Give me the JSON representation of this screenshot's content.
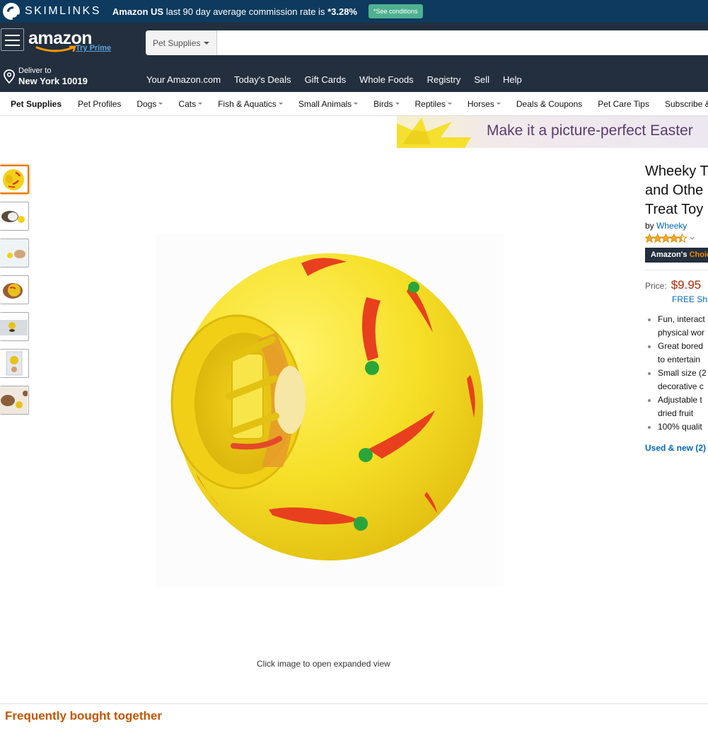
{
  "skimlinks": {
    "brand": "SKIMLINKS",
    "store": "Amazon US",
    "message": "last 90 day average commission rate is",
    "rate": "*3.28%",
    "conditions_button": "*See conditions"
  },
  "header": {
    "logo_text": "amazon",
    "prime_text": "Try Prime",
    "search_category": "Pet Supplies",
    "search_value": "",
    "deliver_to_label": "Deliver to",
    "deliver_location": "New York 10019",
    "nav_links": [
      "Your Amazon.com",
      "Today's Deals",
      "Gift Cards",
      "Whole Foods",
      "Registry",
      "Sell",
      "Help"
    ]
  },
  "subnav": {
    "items": [
      {
        "label": "Pet Supplies",
        "dropdown": false
      },
      {
        "label": "Pet Profiles",
        "dropdown": false
      },
      {
        "label": "Dogs",
        "dropdown": true
      },
      {
        "label": "Cats",
        "dropdown": true
      },
      {
        "label": "Fish & Aquatics",
        "dropdown": true
      },
      {
        "label": "Small Animals",
        "dropdown": true
      },
      {
        "label": "Birds",
        "dropdown": true
      },
      {
        "label": "Reptiles",
        "dropdown": true
      },
      {
        "label": "Horses",
        "dropdown": true
      },
      {
        "label": "Deals & Coupons",
        "dropdown": false
      },
      {
        "label": "Pet Care Tips",
        "dropdown": false
      },
      {
        "label": "Subscribe &",
        "dropdown": false
      }
    ]
  },
  "banner": {
    "text": "Make it a picture-perfect Easter"
  },
  "gallery": {
    "thumbnail_count": 7,
    "caption": "Click image to open expanded view"
  },
  "product": {
    "title_lines": [
      "Wheeky T",
      "and Othe",
      "Treat Toy"
    ],
    "by_label": "by",
    "brand": "Wheeky",
    "rating_stars": 4.5,
    "badge_prefix": "Amazon's",
    "badge_suffix": "Choice",
    "price_label": "Price:",
    "price": "$9.95",
    "shipping": "FREE Shi",
    "bullets": [
      "Fun, interact",
      "physical wor",
      "Great bored",
      "to entertain",
      "Small size (2",
      "decorative c",
      "Adjustable t",
      "dried fruit",
      "100% qualit"
    ],
    "bullet_starts": [
      0,
      2,
      4,
      6,
      8
    ],
    "used_new": "Used & new (2)"
  },
  "section": {
    "frequently_bought": "Frequently bought together"
  },
  "colors": {
    "nav_dark": "#232f3e",
    "skim_bar": "#0d3a5e",
    "price_red": "#b12704",
    "link_blue": "#0066c0",
    "section_orange": "#c45500",
    "active_thumb": "#e77600"
  }
}
